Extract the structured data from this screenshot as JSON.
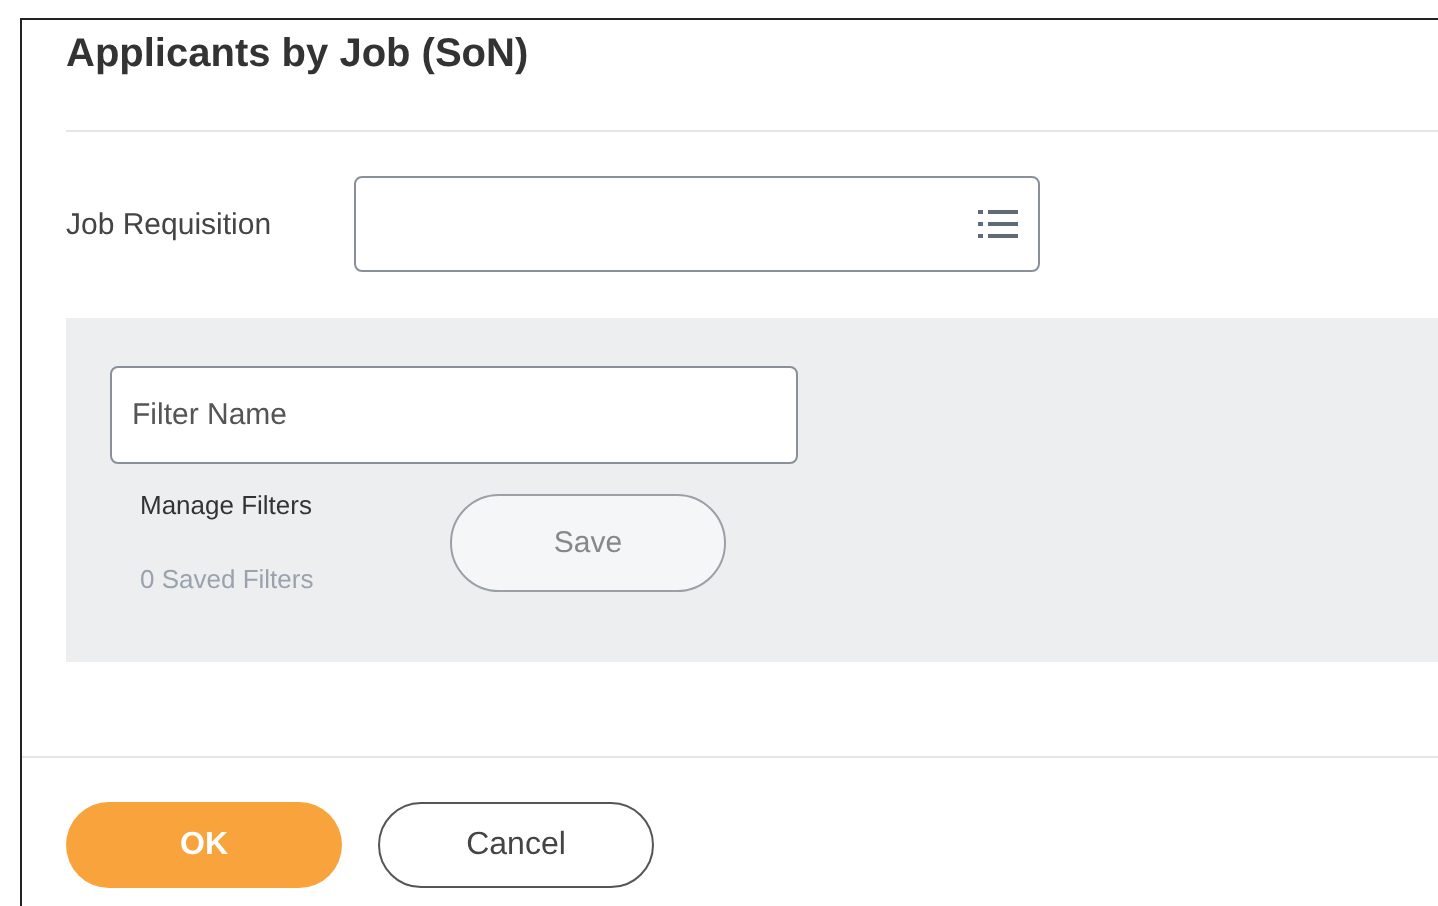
{
  "title": "Applicants by Job (SoN)",
  "job_requisition": {
    "label": "Job Requisition"
  },
  "filters": {
    "name_field": {
      "placeholder": "Filter Name"
    },
    "manage_link": "Manage Filters",
    "saved_count": "0 Saved Filters",
    "save_button": {
      "label": "Save",
      "disabled": true
    }
  },
  "buttons": [
    {
      "label": "OK",
      "kind": "primary"
    },
    {
      "label": "Cancel",
      "kind": "secondary"
    }
  ]
}
